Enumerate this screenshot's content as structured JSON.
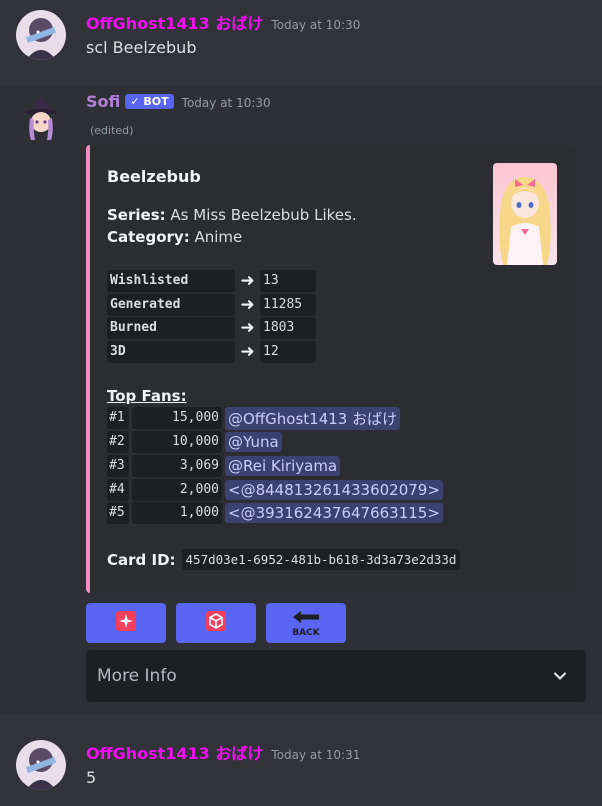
{
  "messages": [
    {
      "username": "OffGhost1413 おばけ",
      "username_color": "#f10ff1",
      "timestamp": "Today at 10:30",
      "content": "scl Beelzebub"
    },
    {
      "username": "Sofi",
      "username_color": "#b27ed8",
      "bot_badge": "✓ BOT",
      "timestamp": "Today at 10:30",
      "edited": "(edited)",
      "embed": {
        "accent_color": "#ee8fc0",
        "title": "Beelzebub",
        "series_label": "Series:",
        "series_value": "As Miss Beelzebub Likes.",
        "category_label": "Category:",
        "category_value": "Anime",
        "stats": [
          {
            "name": "Wishlisted",
            "arrow": "➜",
            "value": "13"
          },
          {
            "name": "Generated",
            "arrow": "➜",
            "value": "11285"
          },
          {
            "name": "Burned",
            "arrow": "➜",
            "value": "1803"
          },
          {
            "name": "3D",
            "arrow": "➜",
            "value": "12"
          }
        ],
        "top_fans_label": "Top Fans:",
        "top_fans": [
          {
            "rank": "#1",
            "score": "15,000",
            "user": "@OffGhost1413 おばけ"
          },
          {
            "rank": "#2",
            "score": "10,000",
            "user": "@Yuna"
          },
          {
            "rank": "#3",
            "score": "3,069",
            "user": "@Rei Kiriyama"
          },
          {
            "rank": "#4",
            "score": "2,000",
            "user": "<@844813261433602079>"
          },
          {
            "rank": "#5",
            "score": "1,000",
            "user": "<@393162437647663115>"
          }
        ],
        "card_id_label": "Card ID:",
        "card_id": "457d03e1-6952-481b-b618-3d3a73e2d33d"
      },
      "buttons": [
        {
          "icon": "sparkle-icon",
          "label": ""
        },
        {
          "icon": "cube-icon",
          "label": ""
        },
        {
          "icon": "back-arrow-icon",
          "label": "BACK"
        }
      ],
      "select_menu": {
        "label": "More Info",
        "icon": "chevron-down-icon"
      }
    },
    {
      "username": "OffGhost1413 おばけ",
      "username_color": "#f10ff1",
      "timestamp": "Today at 10:31",
      "content": "5"
    }
  ]
}
